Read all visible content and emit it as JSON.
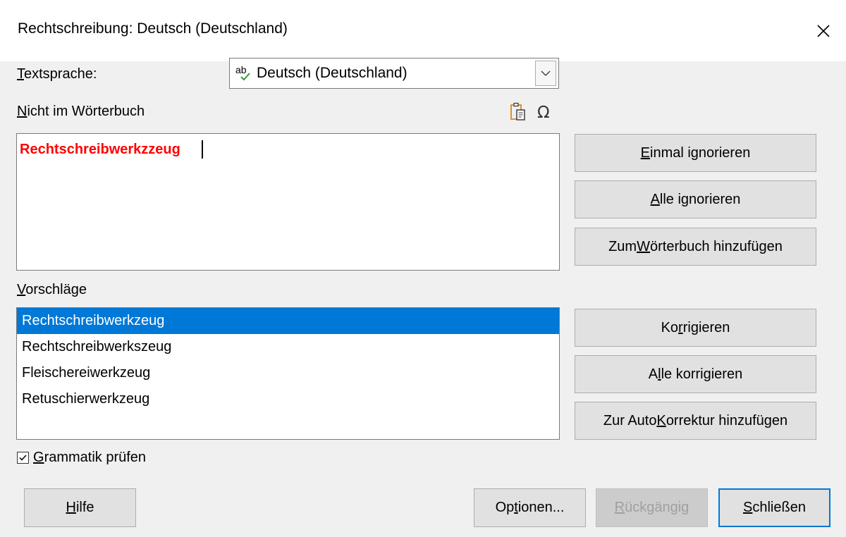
{
  "window": {
    "title": "Rechtschreibung: Deutsch (Deutschland)",
    "close_icon": "close-icon"
  },
  "language": {
    "label_accel": "T",
    "label_rest": "extsprache:",
    "value": "Deutsch (Deutschland)",
    "icon": "spellcheck-icon",
    "dropdown_icon": "chevron-down-icon"
  },
  "not_in_dictionary": {
    "label_accel": "N",
    "label_rest": "icht im Wörterbuch",
    "paste_icon": "paste-icon",
    "special_char_icon": "omega-icon",
    "word": "Rechtschreibwerkzzeug",
    "word_color": "#ff0000"
  },
  "buttons": {
    "ignore_once": {
      "before": "",
      "accel": "E",
      "after": "inmal ignorieren"
    },
    "ignore_all": {
      "before": "",
      "accel": "A",
      "after": "lle ignorieren"
    },
    "add_dictionary": {
      "before": "Zum ",
      "accel": "W",
      "after": "örterbuch hinzufügen"
    },
    "correct": {
      "before": "Ko",
      "accel": "r",
      "after": "rigieren"
    },
    "correct_all": {
      "before": "A",
      "accel": "l",
      "after": "le korrigieren"
    },
    "add_autocorrect": {
      "before": "Zur Auto",
      "accel": "K",
      "after": "orrektur hinzufügen"
    }
  },
  "suggestions": {
    "label_accel": "V",
    "label_rest": "orschläge",
    "items": [
      "Rechtschreibwerkzeug",
      "Rechtschreibwerkszeug",
      "Fleischereiwerkzeug",
      "Retuschierwerkzeug"
    ],
    "selected_index": 0
  },
  "grammar": {
    "checked": true,
    "label_accel": "G",
    "label_rest": "rammatik prüfen"
  },
  "footer": {
    "help": {
      "before": "",
      "accel": "H",
      "after": "ilfe"
    },
    "options": {
      "before": "Op",
      "accel": "t",
      "after": "ionen..."
    },
    "undo": {
      "before": "",
      "accel": "R",
      "after": "ückgängig"
    },
    "close": {
      "before": "",
      "accel": "S",
      "after": "chließen"
    }
  },
  "colors": {
    "accent": "#0078d7",
    "background": "#f0f0f0",
    "error_text": "#ff0000",
    "button_face": "#e1e1e1"
  }
}
